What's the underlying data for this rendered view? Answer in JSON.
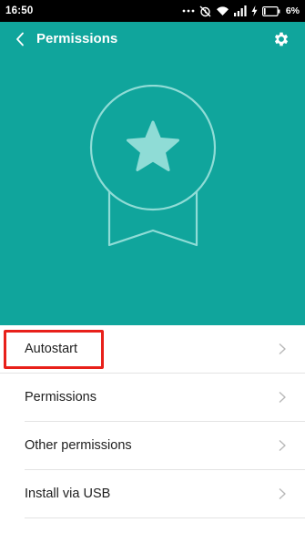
{
  "status_bar": {
    "time": "16:50",
    "battery": "6%",
    "icons": [
      "dots-icon",
      "alarm-off-icon",
      "wifi-icon",
      "signal-icon",
      "charging-icon",
      "battery-icon"
    ]
  },
  "header": {
    "title": "Permissions",
    "back_icon": "chevron-left-icon",
    "settings_icon": "gear-icon",
    "badge_icon": "star-ribbon-badge-icon"
  },
  "list": {
    "items": [
      {
        "label": "Autostart",
        "highlighted": true
      },
      {
        "label": "Permissions"
      },
      {
        "label": "Other permissions"
      },
      {
        "label": "Install via USB"
      }
    ]
  },
  "colors": {
    "header_bg": "#10a59c",
    "badge_light": "#8fdcd6",
    "highlight": "#e8201a",
    "text": "#1e1e1e",
    "chevron": "#b8b8b8"
  }
}
